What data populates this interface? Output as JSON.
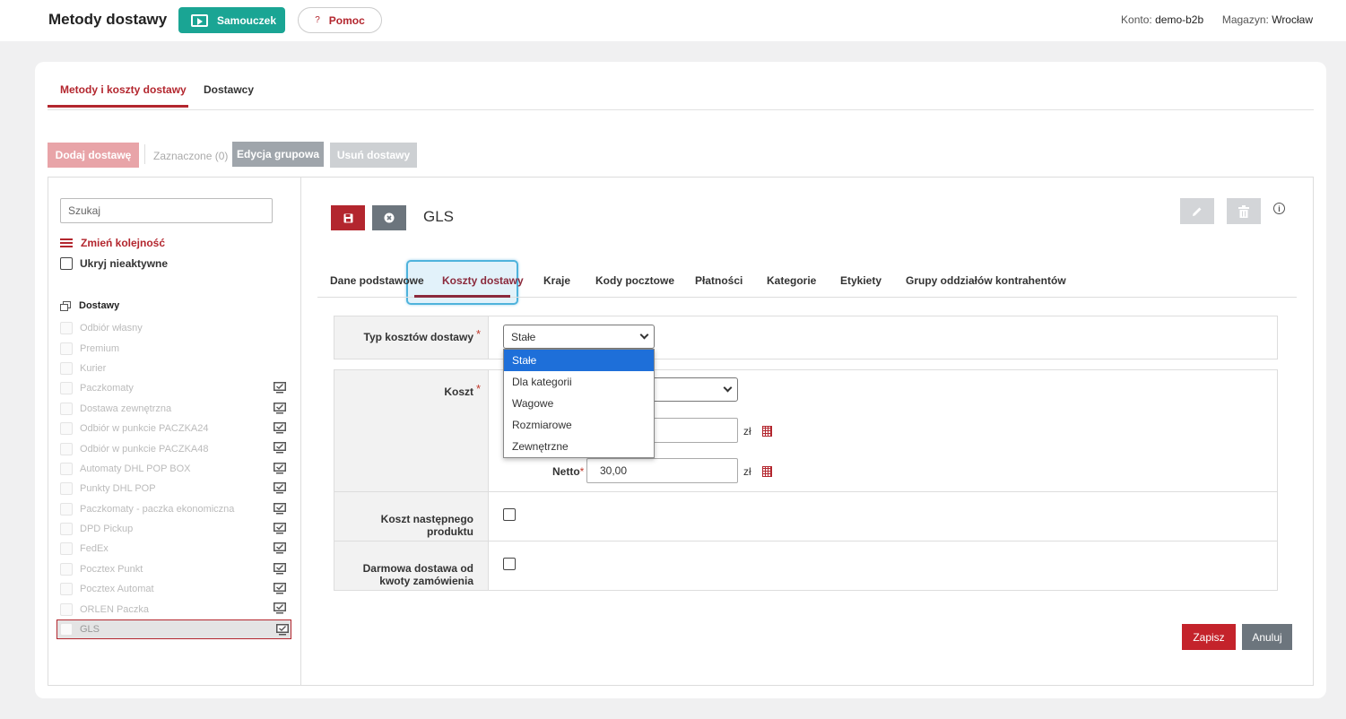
{
  "header": {
    "title": "Metody dostawy",
    "tutorial_label": "Samouczek",
    "help_label": "Pomoc",
    "help_glyph": "?",
    "account_label": "Konto:",
    "account_value": "demo-b2b",
    "warehouse_label": "Magazyn:",
    "warehouse_value": "Wrocław"
  },
  "main_tabs": [
    {
      "label": "Metody i koszty dostawy",
      "active": true
    },
    {
      "label": "Dostawcy",
      "active": false
    }
  ],
  "toolbar": {
    "add_label": "Dodaj dostawę",
    "selected_label": "Zaznaczone (0)",
    "group_edit_label": "Edycja grupowa",
    "delete_label": "Usuń dostawy"
  },
  "left_panel": {
    "search_placeholder": "Szukaj",
    "reorder_label": "Zmień kolejność",
    "hide_inactive_label": "Ukryj nieaktywne",
    "list_heading": "Dostawy",
    "items": [
      {
        "label": "Odbiór własny",
        "monitor": false
      },
      {
        "label": "Premium",
        "monitor": false
      },
      {
        "label": "Kurier",
        "monitor": false
      },
      {
        "label": "Paczkomaty",
        "monitor": true
      },
      {
        "label": "Dostawa zewnętrzna",
        "monitor": true
      },
      {
        "label": "Odbiór w punkcie PACZKA24",
        "monitor": true
      },
      {
        "label": "Odbiór w punkcie PACZKA48",
        "monitor": true
      },
      {
        "label": "Automaty DHL POP BOX",
        "monitor": true
      },
      {
        "label": "Punkty DHL POP",
        "monitor": true
      },
      {
        "label": "Paczkomaty - paczka ekonomiczna",
        "monitor": true
      },
      {
        "label": "DPD Pickup",
        "monitor": true
      },
      {
        "label": "FedEx",
        "monitor": true
      },
      {
        "label": "Pocztex Punkt",
        "monitor": true
      },
      {
        "label": "Pocztex Automat",
        "monitor": true
      },
      {
        "label": "ORLEN Paczka",
        "monitor": true
      },
      {
        "label": "GLS",
        "monitor": true,
        "active": true
      }
    ]
  },
  "detail": {
    "title": "GLS",
    "subtabs": [
      "Dane podstawowe",
      "Koszty dostawy",
      "Kraje",
      "Kody pocztowe",
      "Płatności",
      "Kategorie",
      "Etykiety",
      "Grupy oddziałów kontrahentów"
    ],
    "active_subtab": "Koszty dostawy",
    "cost_type_label": "Typ kosztów dostawy",
    "cost_type_value": "Stałe",
    "cost_type_options": [
      "Stałe",
      "Dla kategorii",
      "Wagowe",
      "Rozmiarowe",
      "Zewnętrzne"
    ],
    "required_mark": "*",
    "cost_label": "Koszt",
    "netto_label": "Netto",
    "netto_value": "30,00",
    "currency": "zł",
    "next_product_cost_label_1": "Koszt następnego",
    "next_product_cost_label_2": "produktu",
    "free_delivery_label_1": "Darmowa dostawa od",
    "free_delivery_label_2": "kwoty zamówienia",
    "submit_label": "Zapisz",
    "cancel_label": "Anuluj"
  },
  "colors": {
    "accent": "#b3262e",
    "teal": "#1aa594",
    "selected_option": "#1e6fd9"
  }
}
